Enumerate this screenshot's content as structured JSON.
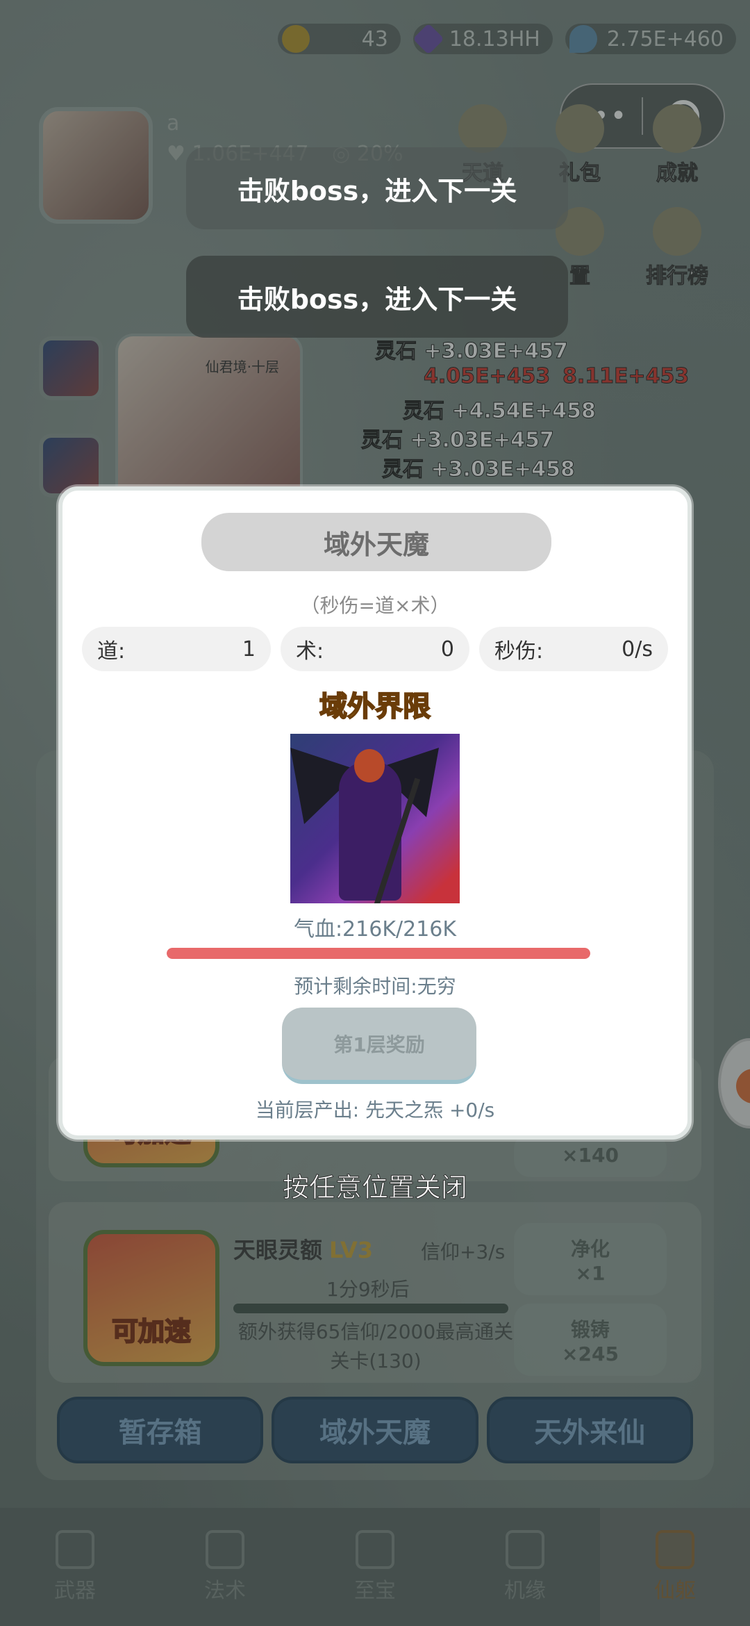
{
  "resources": [
    {
      "name": "gold",
      "value": "43"
    },
    {
      "name": "gem",
      "value": "18.13HH"
    },
    {
      "name": "crystal",
      "value": "2.75E+460"
    }
  ],
  "capsule": {
    "more": "•••"
  },
  "player": {
    "name": "a",
    "hp": "1.06E+447",
    "crit": "20%"
  },
  "side_icons": [
    "天道",
    "礼包",
    "成就",
    "",
    "置",
    "排行榜"
  ],
  "toasts": [
    "击败boss，进入下一关",
    "击败boss，进入下一关"
  ],
  "floaters": [
    "灵石 +3.03E+457",
    "4.05E+453",
    "灵石 +4.54E+458",
    "灵石 +3.03E+457",
    "灵石 +3.03E+458",
    "8.11E+453"
  ],
  "card_tag": "仙君境·十层",
  "modal": {
    "title": "域外天魔",
    "formula": "（秒伤=道×术）",
    "stats": [
      {
        "label": "道:",
        "value": "1"
      },
      {
        "label": "术:",
        "value": "0"
      },
      {
        "label": "秒伤:",
        "value": "0/s"
      }
    ],
    "boss_name": "域外界限",
    "hp": "气血:216K/216K",
    "hp_fraction": 1.0,
    "remaining": "预计剩余时间:无穷",
    "reward_button": "第1层奖励",
    "output": "当前层产出: 先天之炁 +0/s"
  },
  "close_hint": "按任意位置关闭",
  "rows": [
    {
      "speed": "可加速",
      "side_btn": "×140"
    },
    {
      "speed": "可加速",
      "title": "天眼灵额",
      "level": "LV3",
      "income": "信仰+3/s",
      "timer": "1分9秒后",
      "desc": "额外获得65信仰/2000最高通关关卡(130)",
      "btn1_label": "净化",
      "btn1_value": "×1",
      "btn2_label": "锻铸",
      "btn2_value": "×245"
    }
  ],
  "bottom_buttons": [
    "暂存箱",
    "域外天魔",
    "天外来仙"
  ],
  "tabs": [
    {
      "label": "武器",
      "icon": "sword-icon"
    },
    {
      "label": "法术",
      "icon": "book-icon"
    },
    {
      "label": "至宝",
      "icon": "treasure-icon"
    },
    {
      "label": "机缘",
      "icon": "dragon-icon"
    },
    {
      "label": "仙躯",
      "icon": "helmet-icon",
      "active": true
    }
  ]
}
